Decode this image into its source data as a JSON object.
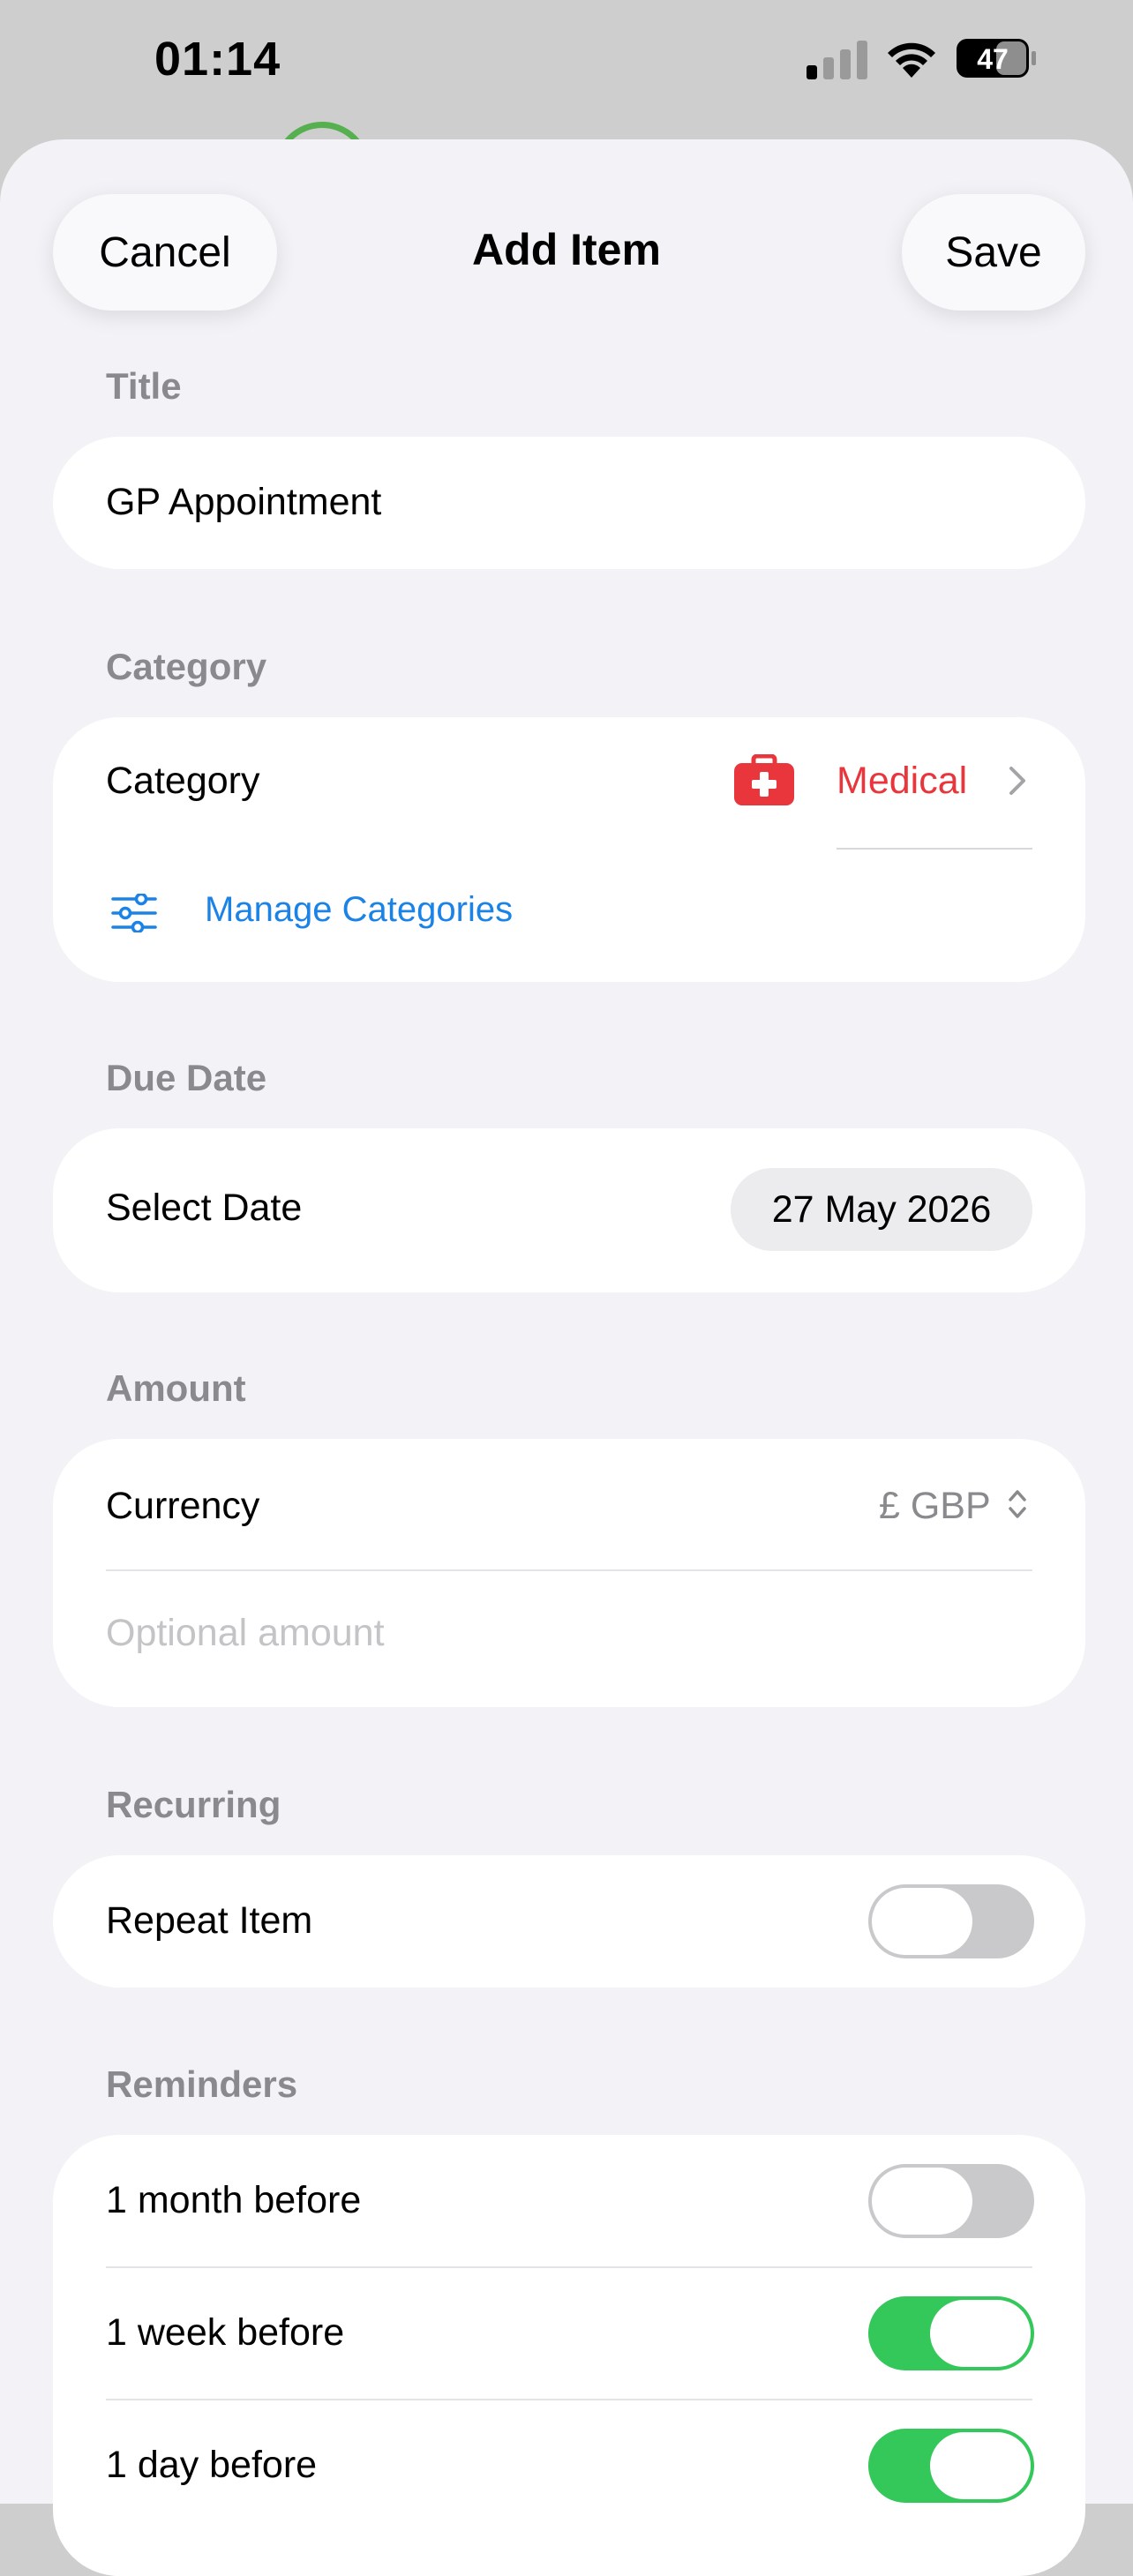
{
  "status_bar": {
    "time": "01:14",
    "battery": "47"
  },
  "nav": {
    "cancel": "Cancel",
    "title": "Add Item",
    "save": "Save"
  },
  "title_section": {
    "label": "Title",
    "value": "GP Appointment"
  },
  "category_section": {
    "label": "Category",
    "row_label": "Category",
    "selected": "Medical",
    "selected_color": "#e8363c",
    "manage_link": "Manage Categories"
  },
  "due_date_section": {
    "label": "Due Date",
    "row_label": "Select Date",
    "value": "27 May 2026"
  },
  "amount_section": {
    "label": "Amount",
    "currency_label": "Currency",
    "currency_value": "£ GBP",
    "amount_placeholder": "Optional amount"
  },
  "recurring_section": {
    "label": "Recurring",
    "row_label": "Repeat Item",
    "enabled": false
  },
  "reminders_section": {
    "label": "Reminders",
    "items": [
      {
        "label": "1 month before",
        "enabled": false
      },
      {
        "label": "1 week before",
        "enabled": true
      },
      {
        "label": "1 day before",
        "enabled": true
      }
    ]
  },
  "colors": {
    "accent_link": "#1b82e6",
    "toggle_on": "#34c759",
    "toggle_off": "#c9c9cc"
  }
}
